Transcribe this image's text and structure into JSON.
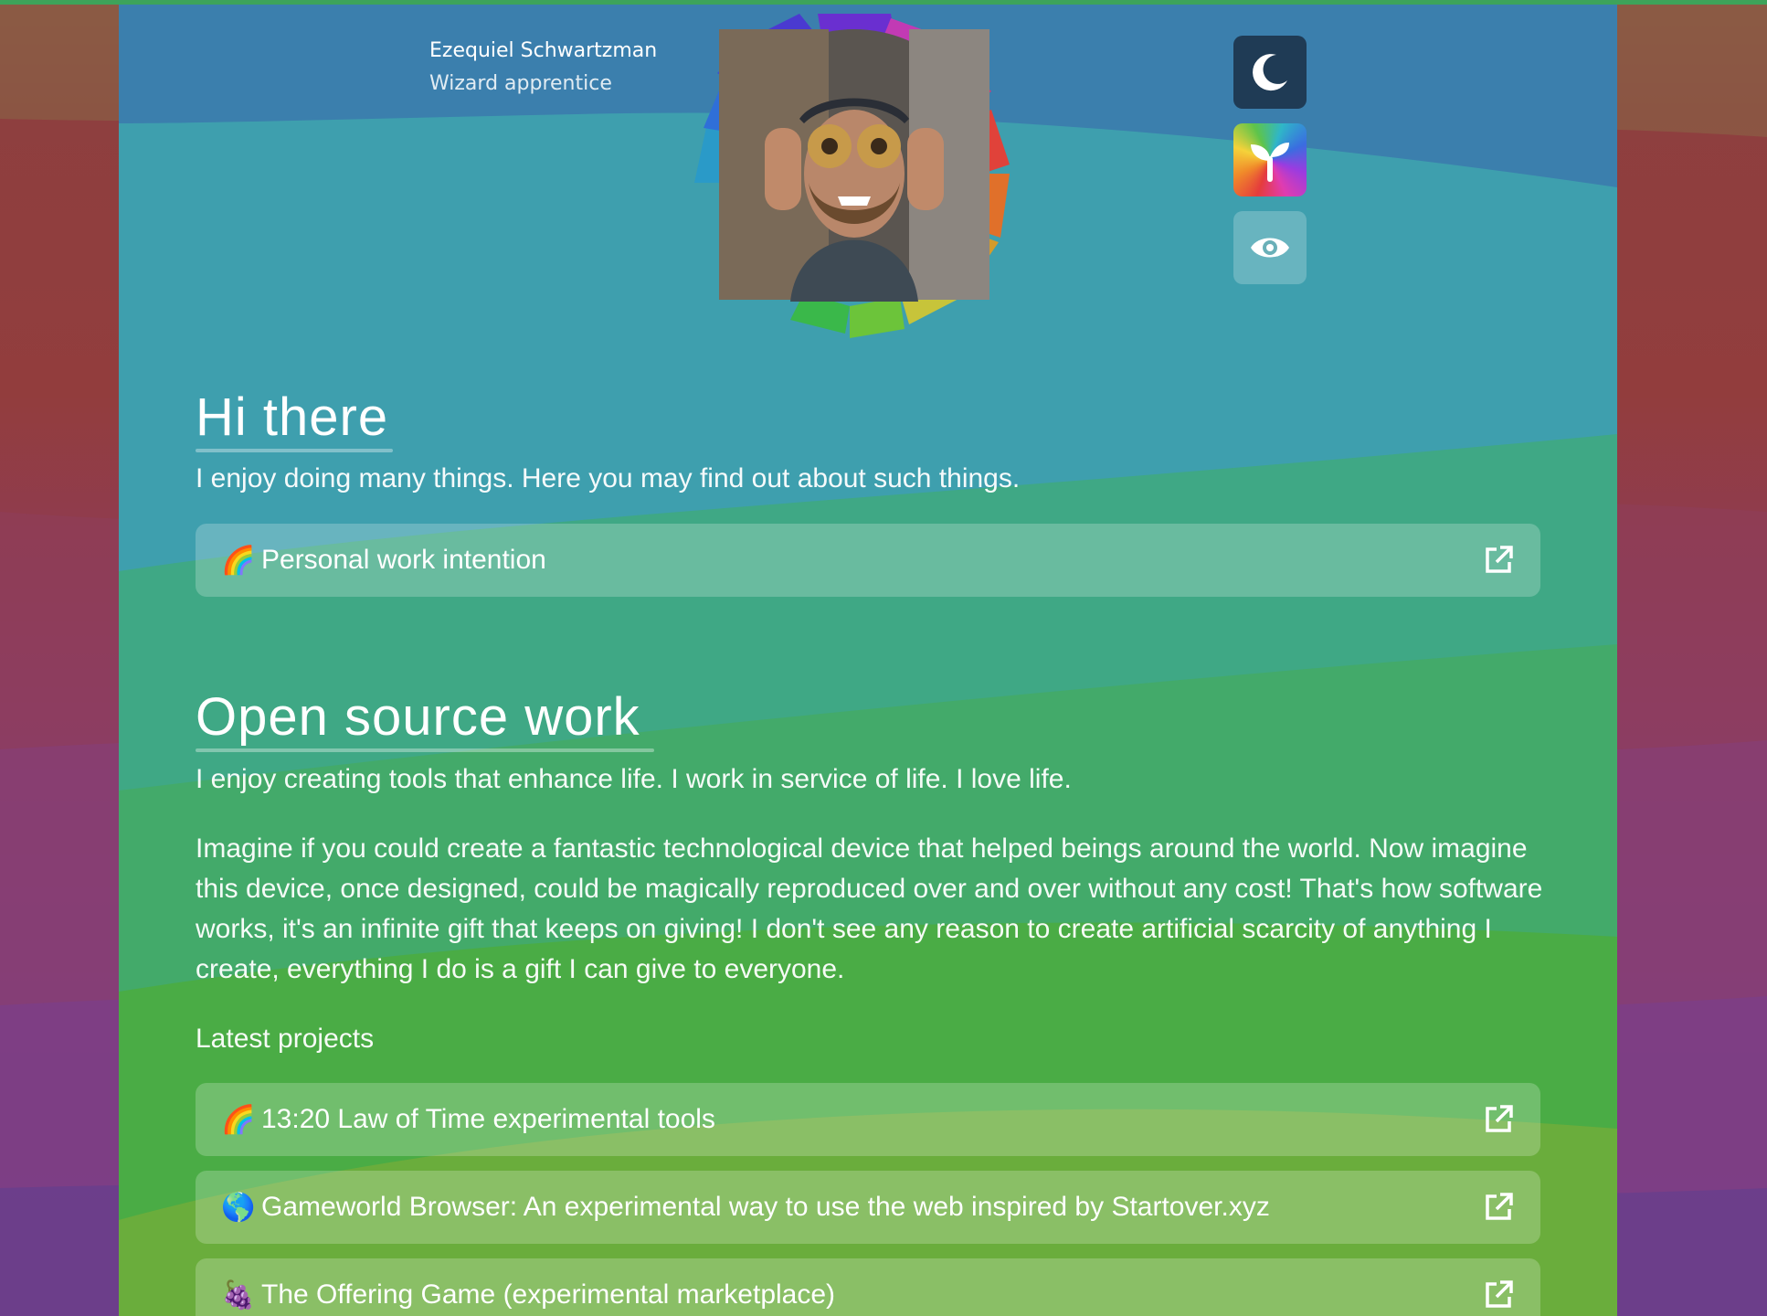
{
  "header": {
    "name": "Ezequiel Schwartzman",
    "role": "Wizard apprentice"
  },
  "toolbar": {
    "buttons": [
      {
        "icon": "moon-icon",
        "label": "dark mode"
      },
      {
        "icon": "sprout-icon",
        "label": "rainbow theme"
      },
      {
        "icon": "eye-icon",
        "label": "view toggle"
      }
    ]
  },
  "intro": {
    "title": "Hi there",
    "subtitle": "I enjoy doing many things. Here you may find out about such things.",
    "links": [
      {
        "emoji": "🌈",
        "label": "Personal work intention"
      }
    ]
  },
  "open_source": {
    "title": "Open source work",
    "subtitle": "I enjoy creating tools that enhance life. I work in service of life. I love life.",
    "paragraph": "Imagine if you could create a fantastic technological device that helped beings around the world. Now imagine this device, once designed, could be magically reproduced over and over without any cost! That's how software works, it's an infinite gift that keeps on giving! I don't see any reason to create artificial scarcity of anything I create, everything I do is a gift I can give to everyone.",
    "latest_heading": "Latest projects",
    "projects": [
      {
        "emoji": "🌈",
        "label": "13:20 Law of Time experimental tools"
      },
      {
        "emoji": "🌎",
        "label": "Gameworld Browser: An experimental way to use the web inspired by Startover.xyz"
      },
      {
        "emoji": "🍇",
        "label": "The Offering Game (experimental marketplace)"
      }
    ]
  },
  "colors": {
    "accent_dark": "#1f3b55",
    "page_top": "#3b7fad",
    "page_bottom": "#6fb03e"
  }
}
